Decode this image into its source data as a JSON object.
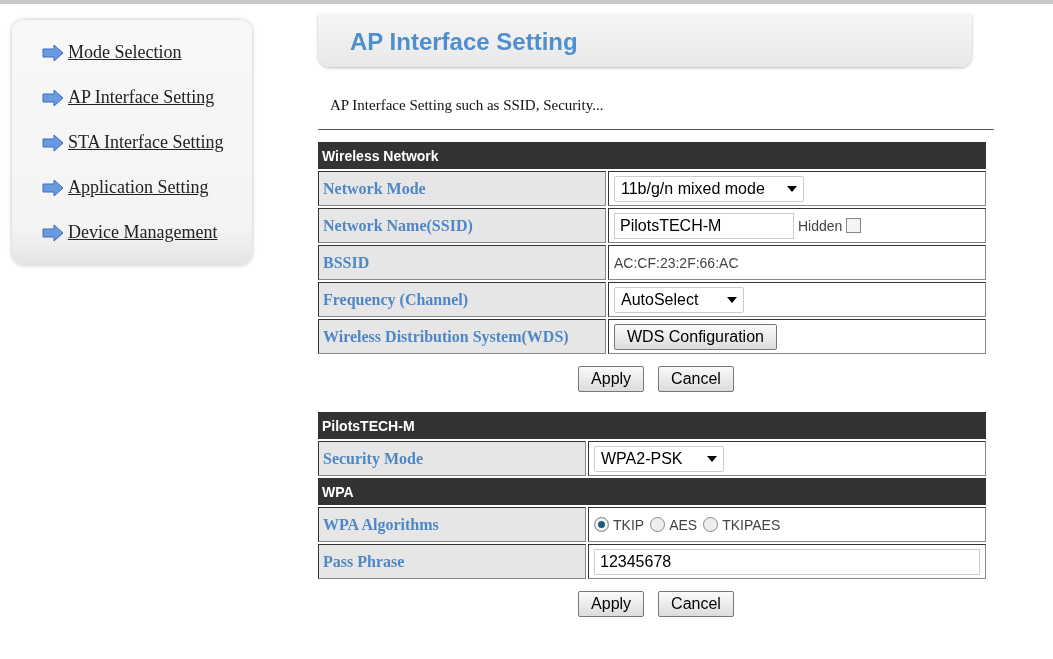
{
  "sidebar": {
    "items": [
      {
        "label": "Mode Selection"
      },
      {
        "label": "AP Interface Setting"
      },
      {
        "label": "STA Interface Setting"
      },
      {
        "label": "Application Setting"
      },
      {
        "label": "Device Management"
      }
    ]
  },
  "header": {
    "title": "AP Interface Setting"
  },
  "description": "AP Interface Setting such as SSID, Security...",
  "forms": [
    {
      "groups": [
        {
          "title": "Wireless Network",
          "rows": [
            {
              "label": "Network Mode",
              "kind": "select",
              "value": "11b/g/n mixed mode"
            },
            {
              "label": "Network Name(SSID)",
              "kind": "input",
              "value": "PilotsTECH-M",
              "checkbox": {
                "label": "Hidden",
                "checked": false
              }
            },
            {
              "label": "BSSID",
              "kind": "text",
              "value": "AC:CF:23:2F:66:AC"
            },
            {
              "label": "Frequency (Channel)",
              "kind": "select",
              "value": "AutoSelect"
            },
            {
              "label": "Wireless Distribution System(WDS)",
              "kind": "button",
              "value": "WDS Configuration"
            }
          ]
        }
      ],
      "buttons": [
        "Apply",
        "Cancel"
      ]
    },
    {
      "groups": [
        {
          "title": "PilotsTECH-M",
          "rows": [
            {
              "label": "Security Mode",
              "kind": "select",
              "value": "WPA2-PSK"
            }
          ]
        },
        {
          "title": "WPA",
          "rows": [
            {
              "label": "WPA Algorithms",
              "kind": "radio",
              "options": [
                {
                  "label": "TKIP",
                  "selected": true
                },
                {
                  "label": "AES",
                  "selected": false
                },
                {
                  "label": "TKIPAES",
                  "selected": false
                }
              ]
            },
            {
              "label": "Pass Phrase",
              "kind": "input",
              "value": "12345678"
            }
          ]
        }
      ],
      "buttons": [
        "Apply",
        "Cancel"
      ]
    }
  ]
}
